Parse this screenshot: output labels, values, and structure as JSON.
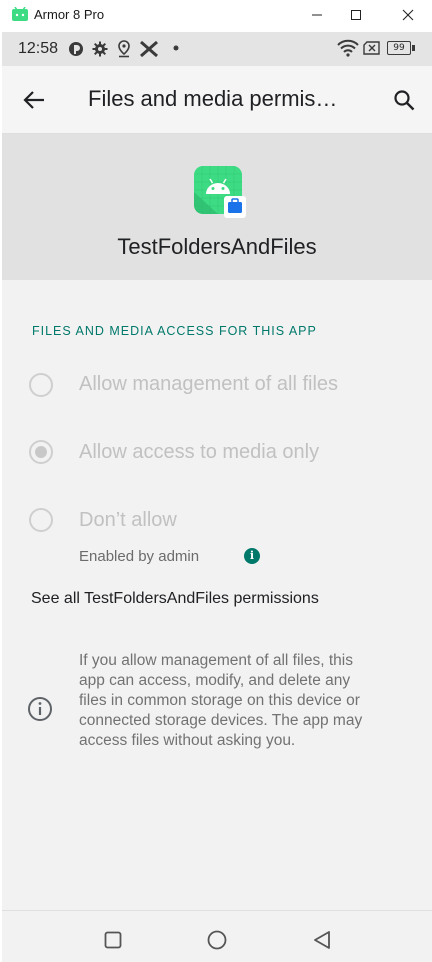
{
  "window": {
    "title": "Armor 8 Pro",
    "controls": [
      "minimize-icon",
      "maximize-icon",
      "close-icon"
    ]
  },
  "status_bar": {
    "time": "12:58",
    "battery": "99",
    "left_icons": [
      "data-saver-icon",
      "settings-icon",
      "location-icon",
      "x-app-icon",
      "dot-icon"
    ],
    "right_icons": [
      "wifi-icon",
      "no-sim-icon",
      "battery-icon"
    ]
  },
  "app_bar": {
    "title": "Files and media permis…",
    "back_icon": "arrow-left-icon",
    "search_icon": "search-icon"
  },
  "app_header": {
    "app_name": "TestFoldersAndFiles",
    "icon": "android-app-icon"
  },
  "section": {
    "label": "FILES AND MEDIA ACCESS FOR THIS APP"
  },
  "options": [
    {
      "label": "Allow management of all files",
      "selected": false,
      "enabled": false
    },
    {
      "label": "Allow access to media only",
      "selected": true,
      "enabled": false
    },
    {
      "label": "Don’t allow",
      "selected": false,
      "enabled": false
    }
  ],
  "admin_note": {
    "text": "Enabled by admin",
    "icon": "info-filled-icon"
  },
  "see_all_link": "See all TestFoldersAndFiles permissions",
  "info": {
    "icon": "info-outline-icon",
    "text": "If you allow management of all files, this app can access, modify, and delete any files in common storage on this device or connected storage devices. The app may access files without asking you."
  },
  "nav_bar": [
    "recents-icon",
    "home-icon",
    "back-icon"
  ],
  "colors": {
    "accent": "#00796b",
    "disabled_text": "#c1c1c1",
    "header_bg": "#e1e1e1"
  }
}
